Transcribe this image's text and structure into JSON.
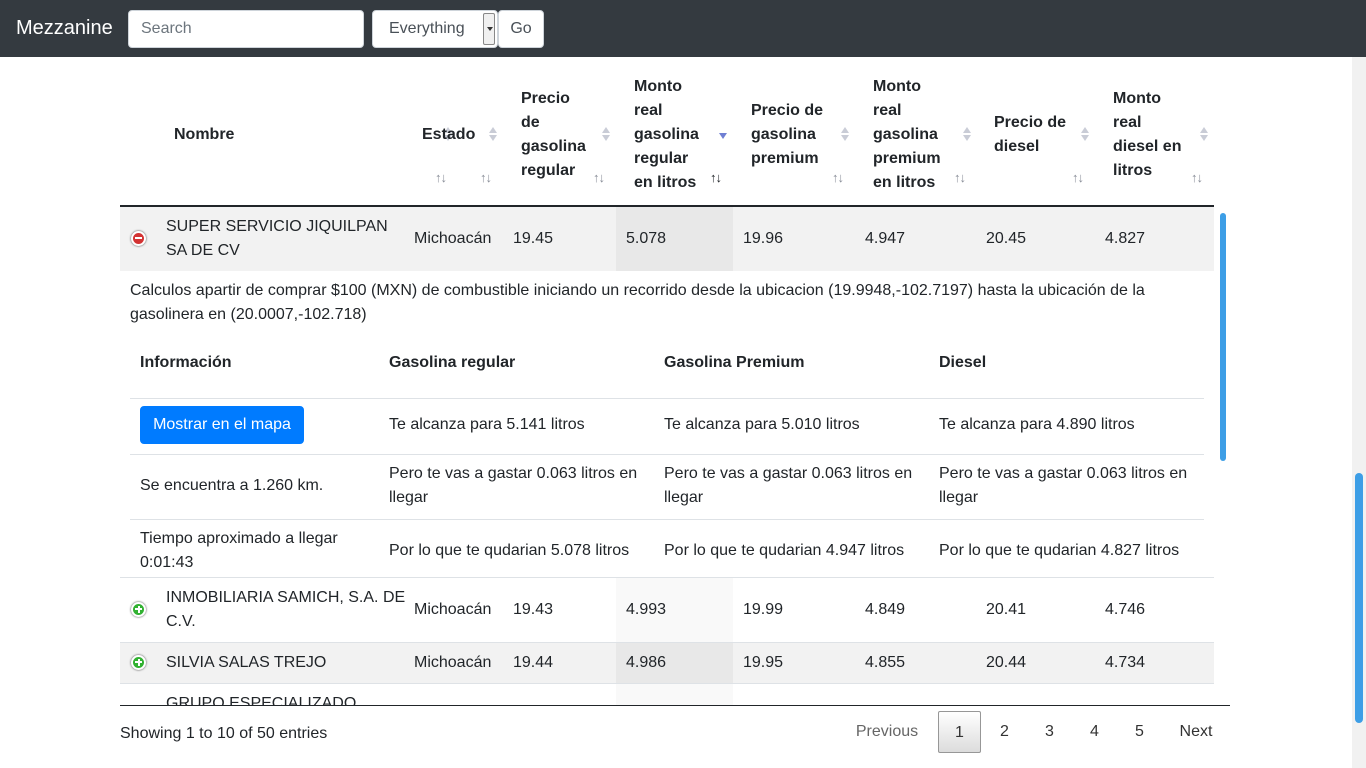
{
  "navbar": {
    "brand": "Mezzanine",
    "search_placeholder": "Search",
    "scope_selected": "Everything",
    "go_label": "Go"
  },
  "table": {
    "columns": [
      "Nombre",
      "Estado",
      "Precio de gasolina regular",
      "Monto real gasolina regular en litros",
      "Precio de gasolina premium",
      "Monto real gasolina premium en litros",
      "Precio de diesel",
      "Monto real diesel en litros"
    ],
    "sorted_column": "Monto real gasolina regular en litros",
    "sort_arrows": "↑↓",
    "rows": [
      {
        "nombre": "SUPER SERVICIO JIQUILPAN SA DE CV",
        "estado": "Michoacán",
        "precio_regular": "19.45",
        "monto_regular": "5.078",
        "precio_premium": "19.96",
        "monto_premium": "4.947",
        "precio_diesel": "20.45",
        "monto_diesel": "4.827",
        "expanded": true
      },
      {
        "nombre": "INMOBILIARIA SAMICH, S.A. DE C.V.",
        "estado": "Michoacán",
        "precio_regular": "19.43",
        "monto_regular": "4.993",
        "precio_premium": "19.99",
        "monto_premium": "4.849",
        "precio_diesel": "20.41",
        "monto_diesel": "4.746",
        "expanded": false
      },
      {
        "nombre": "SILVIA SALAS TREJO",
        "estado": "Michoacán",
        "precio_regular": "19.44",
        "monto_regular": "4.986",
        "precio_premium": "19.95",
        "monto_premium": "4.855",
        "precio_diesel": "20.44",
        "monto_diesel": "4.734",
        "expanded": false
      },
      {
        "nombre": "GRUPO ESPECIALIZADO",
        "estado": "",
        "precio_regular": "",
        "monto_regular": "",
        "precio_premium": "",
        "monto_premium": "",
        "precio_diesel": "",
        "monto_diesel": "",
        "expanded": false
      }
    ]
  },
  "detail": {
    "description": "Calculos apartir de comprar $100 (MXN) de combustible iniciando un recorrido desde la ubicacion (19.9948,-102.7197) hasta la ubicación de la gasolinera en (20.0007,-102.718)",
    "headers": [
      "Información",
      "Gasolina regular",
      "Gasolina Premium",
      "Diesel"
    ],
    "map_button": "Mostrar en el mapa",
    "distance": "Se encuentra a 1.260 km.",
    "time": "Tiempo aproximado a llegar 0:01:43",
    "alcanza": [
      "Te alcanza para 5.141 litros",
      "Te alcanza para 5.010 litros",
      "Te alcanza para 4.890 litros"
    ],
    "gastar": [
      "Pero te vas a gastar 0.063 litros en llegar",
      "Pero te vas a gastar 0.063 litros en llegar",
      "Pero te vas a gastar 0.063 litros en llegar"
    ],
    "quedarian": [
      "Por lo que te qudarian 5.078 litros",
      "Por lo que te qudarian 4.947 litros",
      "Por lo que te qudarian 4.827 litros"
    ]
  },
  "footer": {
    "info": "Showing 1 to 10 of 50 entries",
    "previous": "Previous",
    "next": "Next",
    "pages": [
      "1",
      "2",
      "3",
      "4",
      "5"
    ],
    "current_page": "1"
  },
  "colors": {
    "navbar_bg": "#343a40",
    "primary_button": "#007bff",
    "expand_open": "#d33333",
    "expand_closed": "#31b131",
    "scrollbar": "#3d9ee6"
  }
}
